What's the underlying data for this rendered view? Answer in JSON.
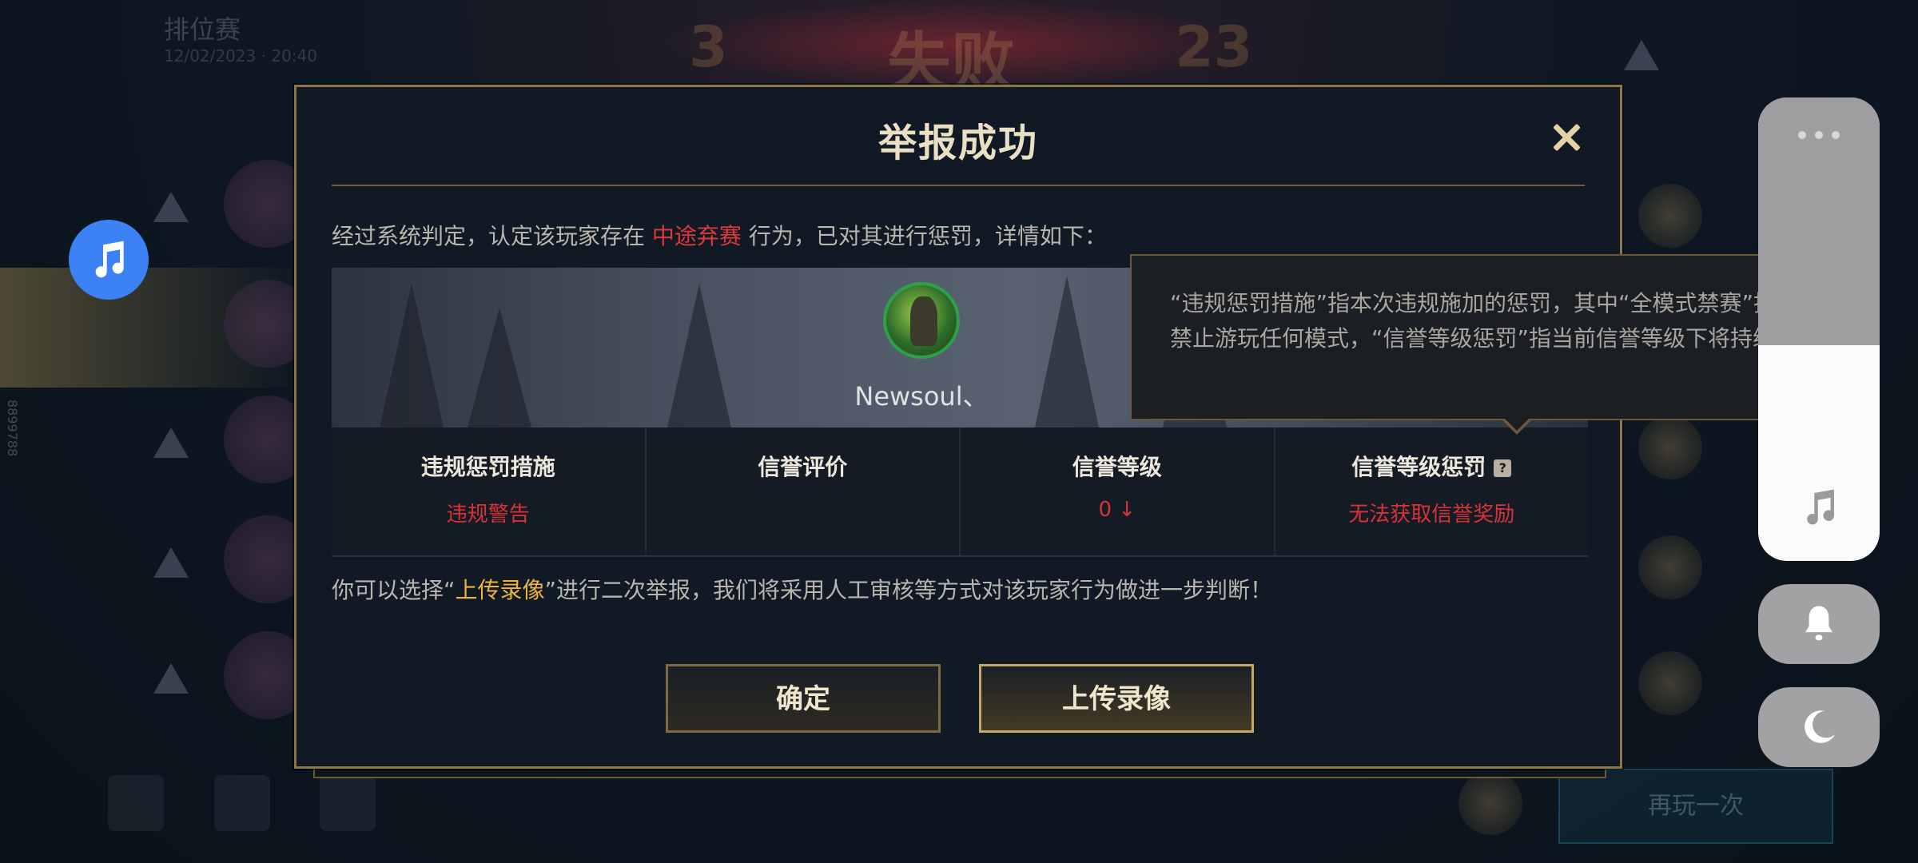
{
  "background": {
    "mode_title": "排位赛",
    "mode_subtitle": "12/02/2023 · 20:40",
    "score_left": "3",
    "result": "失败",
    "score_right": "23",
    "side_id": "8899788",
    "play_again": "再玩一次"
  },
  "dialog": {
    "title": "举报成功",
    "desc_prefix": "经过系统判定，认定该玩家存在 ",
    "desc_violation": "中途弃赛",
    "desc_suffix": " 行为，已对其进行惩罚，详情如下：",
    "player_name": "Newsoul、",
    "stats": [
      {
        "header": "违规惩罚措施",
        "value": "违规警告"
      },
      {
        "header": "信誉评价",
        "value": ""
      },
      {
        "header": "信誉等级",
        "value": "0 ↓"
      },
      {
        "header": "信誉等级惩罚",
        "value": "无法获取信誉奖励"
      }
    ],
    "help_glyph": "?",
    "note_prefix": "你可以选择“",
    "note_highlight": "上传录像",
    "note_suffix": "”进行二次举报，我们将采用人工审核等方式对该玩家行为做进一步判断！",
    "confirm_label": "确定",
    "upload_label": "上传录像"
  },
  "tooltip": {
    "text": "“违规惩罚措施”指本次违规施加的惩罚，其中“全模式禁赛”指一段时间内禁止游玩任何模式，“信誉等级惩罚”指当前信誉等级下将持续受到的惩罚"
  },
  "colors": {
    "accent_gold": "#f0b43a",
    "alert_red": "#e0373d",
    "float_button_blue": "#3d82f5"
  },
  "icons": {
    "close": "close-icon",
    "float_music": "music-note-icon",
    "panel_more": "more-dots-icon",
    "panel_music": "music-note-icon",
    "bell": "bell-icon",
    "moon": "moon-icon"
  }
}
